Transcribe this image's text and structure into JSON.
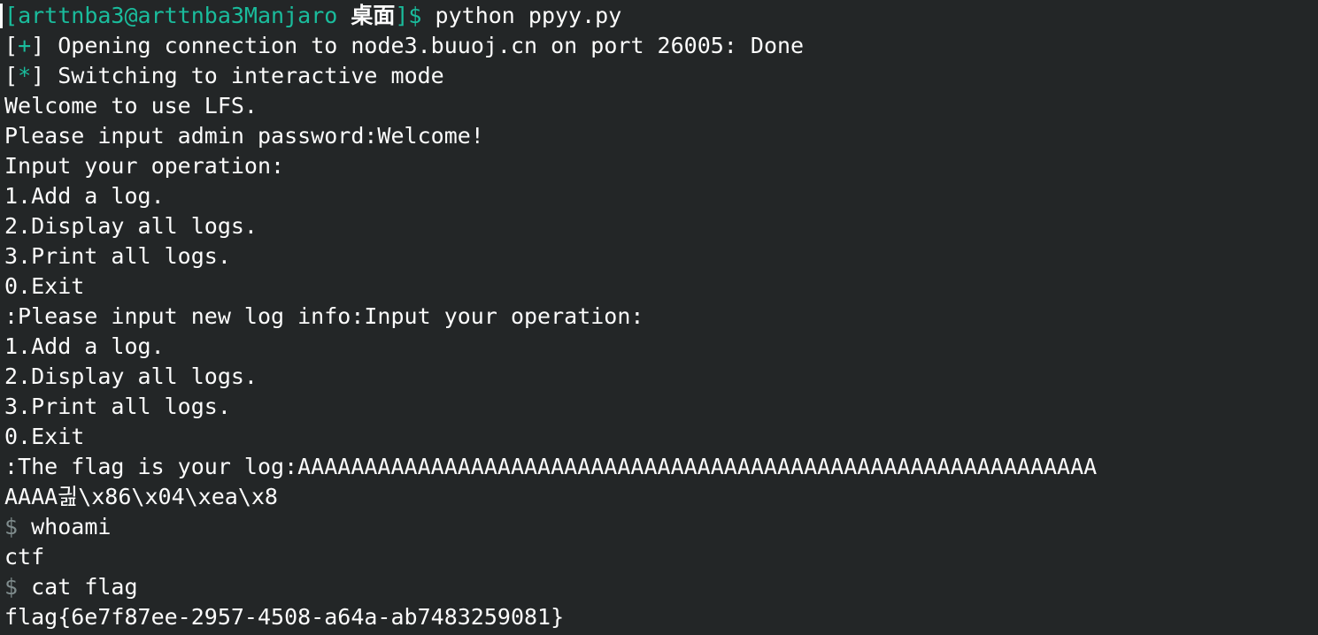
{
  "colors": {
    "background": "#232627",
    "text": "#fcfcfc",
    "accent": "#1abc9c",
    "muted": "#7f8c8d"
  },
  "prompt": {
    "open_bracket": "[",
    "user_host": "arttnba3@arttnba3Manjaro",
    "directory": "桌面",
    "close_bracket": "]$",
    "command": " python ppyy.py"
  },
  "status": [
    {
      "open": "[",
      "mark": "+",
      "close": "]",
      "text": " Opening connection to node3.buuoj.cn on port 26005: Done"
    },
    {
      "open": "[",
      "mark": "*",
      "close": "]",
      "text": " Switching to interactive mode"
    }
  ],
  "output": [
    "Welcome to use LFS.",
    "Please input admin password:Welcome!",
    "Input your operation:",
    "1.Add a log.",
    "2.Display all logs.",
    "3.Print all logs.",
    "0.Exit",
    ":Please input new log info:Input your operation:",
    "1.Add a log.",
    "2.Display all logs.",
    "3.Print all logs.",
    "0.Exit",
    ":The flag is your log:AAAAAAAAAAAAAAAAAAAAAAAAAAAAAAAAAAAAAAAAAAAAAAAAAAAAAAAAAAAA",
    "AAAA긢\\x86\\x04\\xea\\x8"
  ],
  "session": [
    {
      "prompt": "$",
      "command": " whoami",
      "result": "ctf"
    },
    {
      "prompt": "$",
      "command": " cat flag",
      "result": "flag{6e7f87ee-2957-4508-a64a-ab7483259081}"
    }
  ]
}
